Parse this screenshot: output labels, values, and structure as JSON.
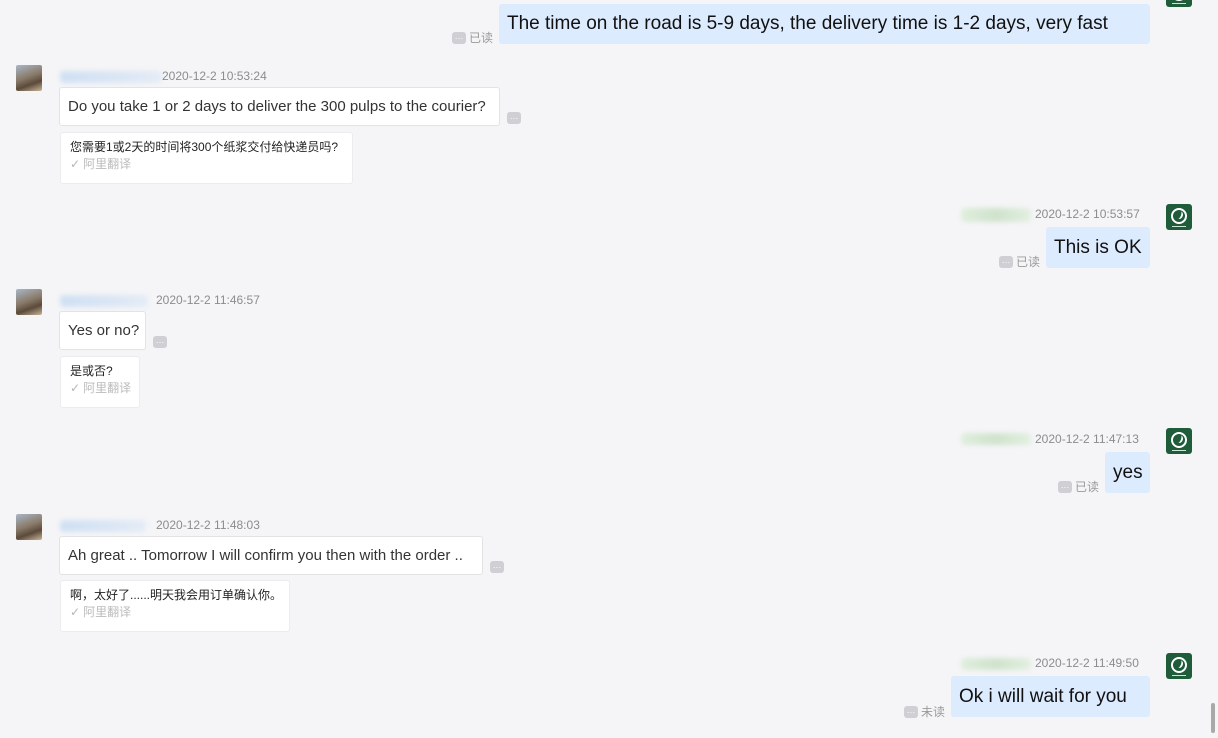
{
  "messages": {
    "m0": {
      "text": "The time on the road is 5-9 days, the delivery time is 1-2 days, very fast",
      "status": "已读"
    },
    "m1": {
      "time": "2020-12-2 10:53:24",
      "text": "Do you take 1 or 2 days to deliver the 300 pulps to the courier?",
      "translation": "您需要1或2天的时间将300个纸浆交付给快递员吗?",
      "translation_source": "阿里翻译"
    },
    "m2": {
      "time": "2020-12-2 10:53:57",
      "text": "This is OK",
      "status": "已读"
    },
    "m3": {
      "time": "2020-12-2 11:46:57",
      "text": "Yes or no?",
      "translation": "是或否?",
      "translation_source": "阿里翻译"
    },
    "m4": {
      "time": "2020-12-2 11:47:13",
      "text": "yes",
      "status": "已读"
    },
    "m5": {
      "time": "2020-12-2 11:48:03",
      "text": "Ah great .. Tomorrow I will confirm you then with the order ..",
      "translation": "啊，太好了......明天我会用订单确认你。",
      "translation_source": "阿里翻译"
    },
    "m6": {
      "time": "2020-12-2 11:49:50",
      "text": "Ok i will wait for you",
      "status": "未读"
    }
  },
  "icons": {
    "more": "ellipsis-icon",
    "check": "checkmark-icon"
  },
  "colors": {
    "background": "#f5f5f7",
    "outgoing_bubble": "#dcebfd",
    "incoming_bubble": "#ffffff",
    "own_avatar": "#1e5c3a"
  }
}
